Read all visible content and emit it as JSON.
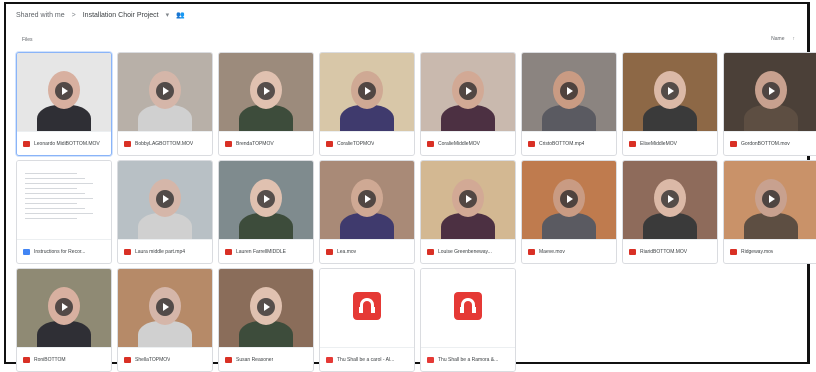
{
  "breadcrumb": {
    "root": "Shared with me",
    "separator": ">",
    "folder": "Installation Choir Project",
    "dropdown": "▾",
    "people_icon": "👥"
  },
  "section_label": "Files",
  "sort_label": "Name",
  "sort_arrow": "↑",
  "files": [
    {
      "name": "Leonardo MidiBOTTOM.MOV",
      "type": "video",
      "thumb": "#e6e6e6"
    },
    {
      "name": "BobbyLAGBOTTOM.MOV",
      "type": "video",
      "thumb": "#b8b0a8"
    },
    {
      "name": "BrendaTOPMOV",
      "type": "video",
      "thumb": "#9c8b7c"
    },
    {
      "name": "CoralieTOPMOV",
      "type": "video",
      "thumb": "#d8c7a8"
    },
    {
      "name": "CoralieMiddleMOV",
      "type": "video",
      "thumb": "#c9b9ae"
    },
    {
      "name": "CristoBOTTOM.mp4",
      "type": "video",
      "thumb": "#8b8480"
    },
    {
      "name": "EliseMiddleMOV",
      "type": "video",
      "thumb": "#8d6846"
    },
    {
      "name": "GordonBOTTOM.mov",
      "type": "video",
      "thumb": "#4b4038"
    },
    {
      "name": "Instructions for Recor...",
      "type": "doc",
      "thumb": "#ffffff"
    },
    {
      "name": "Laura middle part.mp4",
      "type": "video",
      "thumb": "#b8c0c5"
    },
    {
      "name": "Lauren FarrellMIDDLE",
      "type": "video",
      "thumb": "#7f8b8e"
    },
    {
      "name": "Lea.mov",
      "type": "video",
      "thumb": "#a98a77"
    },
    {
      "name": "Louise Greenbeneway...",
      "type": "video",
      "thumb": "#d3b892"
    },
    {
      "name": "Maeve.mov",
      "type": "video",
      "thumb": "#bf7b4e"
    },
    {
      "name": "RiaridBOTTOM.MOV",
      "type": "video",
      "thumb": "#8e6b5b"
    },
    {
      "name": "Ridgeway.mov",
      "type": "video",
      "thumb": "#c99269"
    },
    {
      "name": "RoniBOTTOM",
      "type": "video",
      "thumb": "#8f8a74"
    },
    {
      "name": "ShellaTOPMOV",
      "type": "video",
      "thumb": "#b68a68"
    },
    {
      "name": "Susan Reasoner",
      "type": "video",
      "thumb": "#8a6d5a"
    },
    {
      "name": "Thu Shall be a carol - Al...",
      "type": "pdf",
      "thumb": "#ffffff"
    },
    {
      "name": "Thu Shall be a Ramora &...",
      "type": "pdf",
      "thumb": "#ffffff"
    }
  ]
}
